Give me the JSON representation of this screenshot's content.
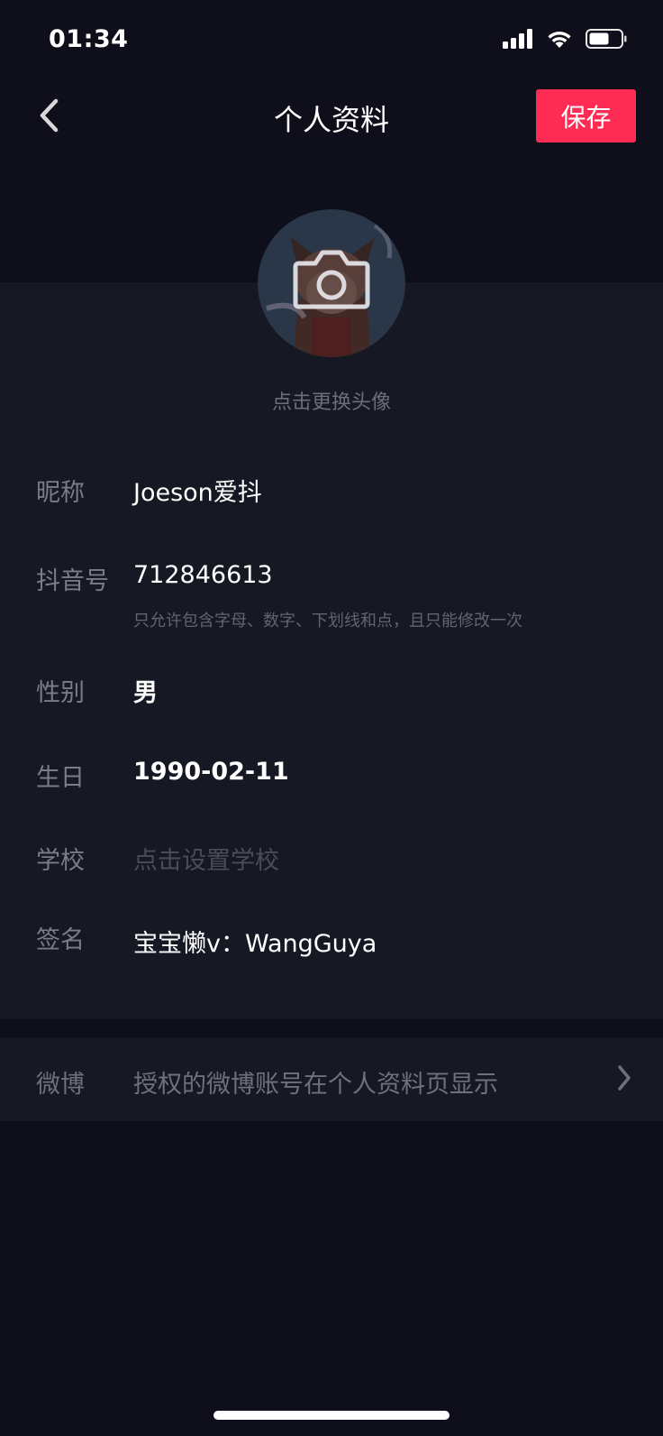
{
  "status_bar": {
    "time": "01:34",
    "icons": [
      "cellular-signal-icon",
      "wifi-icon",
      "battery-icon"
    ]
  },
  "nav": {
    "title": "个人资料",
    "save_label": "保存",
    "back_icon": "back-arrow-icon"
  },
  "avatar": {
    "icon": "camera-icon",
    "hint": "点击更换头像"
  },
  "fields": {
    "nickname": {
      "label": "昵称",
      "value": "Joeson爱抖"
    },
    "douyin_id": {
      "label": "抖音号",
      "value": "712846613",
      "hint": "只允许包含字母、数字、下划线和点，且只能修改一次"
    },
    "gender": {
      "label": "性别",
      "value": "男"
    },
    "birthday": {
      "label": "生日",
      "value": "1990-02-11"
    },
    "school": {
      "label": "学校",
      "placeholder": "点击设置学校"
    },
    "signature": {
      "label": "签名",
      "value": "宝宝懒v：WangGuya"
    }
  },
  "weibo": {
    "label": "微博",
    "text": "授权的微博账号在个人资料页显示",
    "icon": "chevron-right-icon"
  },
  "colors": {
    "background": "#0e0f1a",
    "panel": "#161823",
    "accent": "#fe2c55"
  }
}
